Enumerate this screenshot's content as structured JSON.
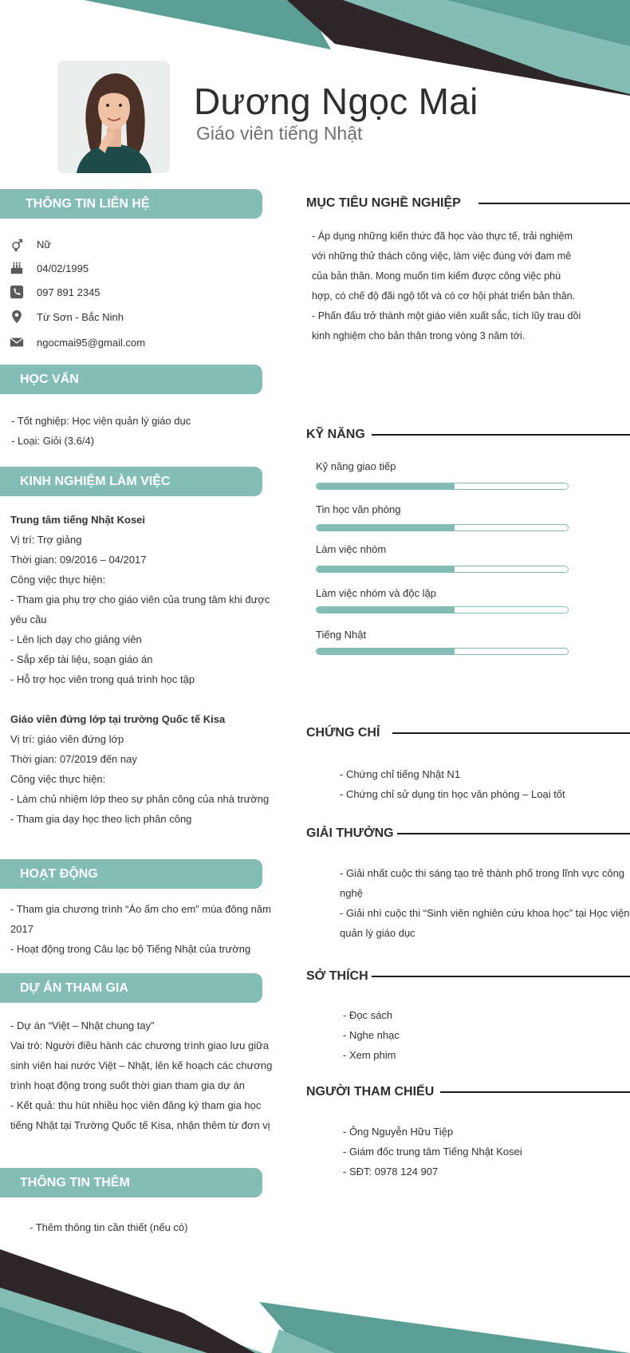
{
  "header": {
    "name": "Dương Ngọc Mai",
    "title": "Giáo viên tiếng Nhật"
  },
  "colors": {
    "accent": "#83bdb6",
    "accent_dark": "#5a9e96",
    "dark": "#2e2628",
    "text": "#333333"
  },
  "contact": {
    "heading": "THÔNG TIN LIÊN HỆ",
    "items": [
      {
        "icon": "gender-icon",
        "value": "Nữ"
      },
      {
        "icon": "birthday-cake-icon",
        "value": "04/02/1995"
      },
      {
        "icon": "phone-icon",
        "value": "097 891 2345"
      },
      {
        "icon": "location-pin-icon",
        "value": "Từ Sơn - Bắc Ninh"
      },
      {
        "icon": "envelope-icon",
        "value": "ngocmai95@gmail.com"
      }
    ]
  },
  "education": {
    "heading": "HỌC VẤN",
    "lines": [
      "- Tốt nghiệp: Học viện quản lý giáo dục",
      "- Loại: Giỏi (3.6/4)"
    ]
  },
  "experience": {
    "heading": "KINH NGHIỆM LÀM VIỆC",
    "jobs": [
      {
        "company": "Trung tâm tiếng Nhật Kosei",
        "lines": [
          "Vị trí: Trợ giảng",
          "Thời gian: 09/2016 – 04/2017",
          "Công việc thực hiện:",
          "- Tham gia phụ trợ cho giáo viên của trung tâm khi được",
          "yêu cầu",
          "- Lên lịch dạy cho giảng viên",
          "- Sắp xếp tài liệu, soạn giáo án",
          "- Hỗ trợ học viên trong quá trình học tập"
        ]
      },
      {
        "company": "Giáo viên đứng lớp tại trường Quốc tế Kisa",
        "lines": [
          "Vị trí: giáo viên đứng lớp",
          "Thời gian: 07/2019 đến nay",
          "Công việc thực hiện:",
          "- Làm chủ nhiệm lớp theo sự phân công của nhà trường",
          "- Tham gia dạy học theo lịch phân công"
        ]
      }
    ]
  },
  "activities": {
    "heading": "HOẠT ĐỘNG",
    "lines": [
      "- Tham gia chương trình “Áo ấm cho em” mùa đông năm",
      "2017",
      "- Hoạt động trong Câu lạc bộ Tiếng Nhật của trường"
    ]
  },
  "projects": {
    "heading": "DỰ ÁN THAM GIA",
    "lines": [
      "- Dự án “Việt – Nhật chung tay”",
      "Vai trò: Người điều hành các chương trình giao lưu giữa",
      "sinh viên hai nước Việt – Nhật, lên kế hoạch các chương",
      "trình hoạt động trong suốt thời gian tham gia dự án",
      "- Kết quả: thu hút nhiều học viên đăng ký tham gia học",
      "tiếng Nhật tại Trường Quốc tế Kisa, nhận thêm từ đơn vị"
    ]
  },
  "extra": {
    "heading": "THÔNG TIN THÊM",
    "lines": [
      "- Thêm thông tin cần thiết (nếu có)"
    ]
  },
  "objective": {
    "heading": "MỤC TIÊU NGHỀ NGHIỆP",
    "lines": [
      "- Áp dụng những kiến thức đã học vào thực tế, trải nghiệm",
      "với những thử thách công việc, làm việc đúng với đam mê",
      "của bản thân. Mong muốn tìm kiếm được công việc phù",
      "hợp, có chế độ đãi ngộ tốt và có cơ hội phát triển bản thân.",
      "- Phấn đấu trở thành một giáo viên xuất sắc, tích lũy trau dồi",
      "kinh nghiệm cho bản thân trong vòng 3 năm tới."
    ]
  },
  "skills": {
    "heading": "KỸ NĂNG",
    "items": [
      {
        "label": "Kỹ năng giao tiếp",
        "level": 0.55
      },
      {
        "label": "Tin học văn phòng",
        "level": 0.55
      },
      {
        "label": "Làm việc nhóm",
        "level": 0.55
      },
      {
        "label": "Làm việc nhóm và độc lập",
        "level": 0.55
      },
      {
        "label": "Tiếng Nhật",
        "level": 0.55
      }
    ]
  },
  "certificates": {
    "heading": "CHỨNG CHỈ",
    "lines": [
      "- Chứng chỉ tiếng Nhật N1",
      "- Chứng chỉ sử dụng tin học văn phòng – Loại tốt"
    ]
  },
  "awards": {
    "heading": "GIẢI THƯỞNG",
    "lines": [
      "- Giải nhất cuộc thi sáng tạo trẻ thành phố trong lĩnh vực công",
      "nghệ",
      "- Giải nhì cuộc thi “Sinh viên nghiên cứu khoa học” tại Học viện",
      "quản lý giáo dục"
    ]
  },
  "hobbies": {
    "heading": "SỞ THÍCH",
    "lines": [
      "- Đọc sách",
      "- Nghe nhạc",
      "- Xem phim"
    ]
  },
  "references": {
    "heading": "NGƯỜI THAM CHIẾU",
    "lines": [
      "- Ông Nguyễn Hữu Tiệp",
      "- Giám đốc trung tâm Tiếng Nhật Kosei",
      "- SĐT: 0978 124 907"
    ]
  }
}
